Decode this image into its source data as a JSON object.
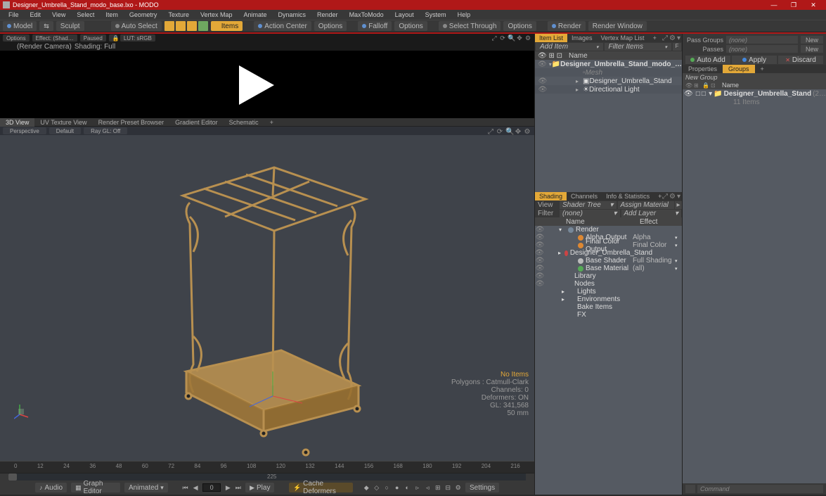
{
  "title": "Designer_Umbrella_Stand_modo_base.lxo - MODO",
  "menu": [
    "File",
    "Edit",
    "View",
    "Select",
    "Item",
    "Geometry",
    "Texture",
    "Vertex Map",
    "Animate",
    "Dynamics",
    "Render",
    "MaxToModo",
    "Layout",
    "System",
    "Help"
  ],
  "toolbar": {
    "model": "Model",
    "sculpt": "Sculpt",
    "auto_select": "Auto Select",
    "items": "Items",
    "action_center": "Action Center",
    "options1": "Options",
    "falloff": "Falloff",
    "options2": "Options",
    "select_through": "Select Through",
    "options3": "Options",
    "render": "Render",
    "render_window": "Render Window"
  },
  "preview": {
    "options": "Options",
    "effect": "Effect: (Shad…",
    "paused": "Paused",
    "lut": "LUT: sRGB",
    "render_camera": "(Render Camera)",
    "shading_full": "Shading: Full"
  },
  "view_tabs": [
    "3D View",
    "UV Texture View",
    "Render Preset Browser",
    "Gradient Editor",
    "Schematic"
  ],
  "view_sub": {
    "persp": "Perspective",
    "def": "Default",
    "raygl": "Ray GL: Off"
  },
  "vp_stats": {
    "warn": "No Items",
    "polygons": "Polygons : Catmull-Clark",
    "channels": "Channels: 0",
    "deformers": "Deformers: ON",
    "gl": "GL: 341,568",
    "scale": "50 mm"
  },
  "timeline": {
    "ticks": [
      "0",
      "12",
      "24",
      "36",
      "48",
      "60",
      "72",
      "84",
      "96",
      "108",
      "120",
      "132",
      "144",
      "156",
      "168",
      "180",
      "192",
      "204",
      "216"
    ],
    "center_label": "225",
    "audio": "Audio",
    "graph_editor": "Graph Editor",
    "animated": "Animated",
    "frame": "0",
    "play": "Play",
    "cache_deformers": "Cache Deformers",
    "settings": "Settings"
  },
  "item_list": {
    "tabs": [
      "Item List",
      "Images",
      "Vertex Map List"
    ],
    "add_item": "Add Item",
    "filter_items": "Filter Items",
    "name_col": "Name",
    "root": "Designer_Umbrella_Stand_modo_…",
    "mesh": "Mesh",
    "item1": "Designer_Umbrella_Stand",
    "item2": "Directional Light"
  },
  "shading": {
    "tabs": [
      "Shading",
      "Channels",
      "Info & Statistics"
    ],
    "view_label": "View",
    "view_val": "Shader Tree",
    "assign_material": "Assign Material",
    "filter_label": "Filter",
    "filter_val": "(none)",
    "add_layer": "Add Layer",
    "name_col": "Name",
    "effect_col": "Effect",
    "rows": [
      {
        "label": "Render",
        "effect": "",
        "indent": 0,
        "exp": "▾",
        "color": "#789"
      },
      {
        "label": "Alpha Output",
        "effect": "Alpha",
        "indent": 1,
        "exp": "",
        "color": "#d83"
      },
      {
        "label": "Final Color Output",
        "effect": "Final Color",
        "indent": 1,
        "exp": "",
        "color": "#d83"
      },
      {
        "label": "Designer_Umbrella_Stand",
        "effect": "",
        "indent": 1,
        "exp": "▸",
        "color": "#c44"
      },
      {
        "label": "Base Shader",
        "effect": "Full Shading",
        "indent": 1,
        "exp": "",
        "color": "#bbb"
      },
      {
        "label": "Base Material",
        "effect": "(all)",
        "indent": 1,
        "exp": "",
        "color": "#5a5"
      },
      {
        "label": "Library",
        "effect": "",
        "indent": 0,
        "exp": "",
        "color": ""
      },
      {
        "label": "Nodes",
        "effect": "",
        "indent": 0,
        "exp": "",
        "color": ""
      },
      {
        "label": "Lights",
        "effect": "",
        "indent": -1,
        "exp": "▸",
        "color": ""
      },
      {
        "label": "Environments",
        "effect": "",
        "indent": -1,
        "exp": "▸",
        "color": ""
      },
      {
        "label": "Bake Items",
        "effect": "",
        "indent": -1,
        "exp": "",
        "color": ""
      },
      {
        "label": "FX",
        "effect": "",
        "indent": -1,
        "exp": "",
        "color": ""
      }
    ]
  },
  "right": {
    "pass_groups": "Pass Groups",
    "passes": "Passes",
    "none": "(none)",
    "new": "New",
    "auto_add": "Auto Add",
    "apply": "Apply",
    "discard": "Discard",
    "prop_tabs": [
      "Properties",
      "Groups"
    ],
    "new_group": "New Group",
    "name_col": "Name",
    "grp_item": "Designer_Umbrella_Stand",
    "grp_count": "(2…",
    "grp_sub": "11 Items",
    "command": "Command"
  }
}
